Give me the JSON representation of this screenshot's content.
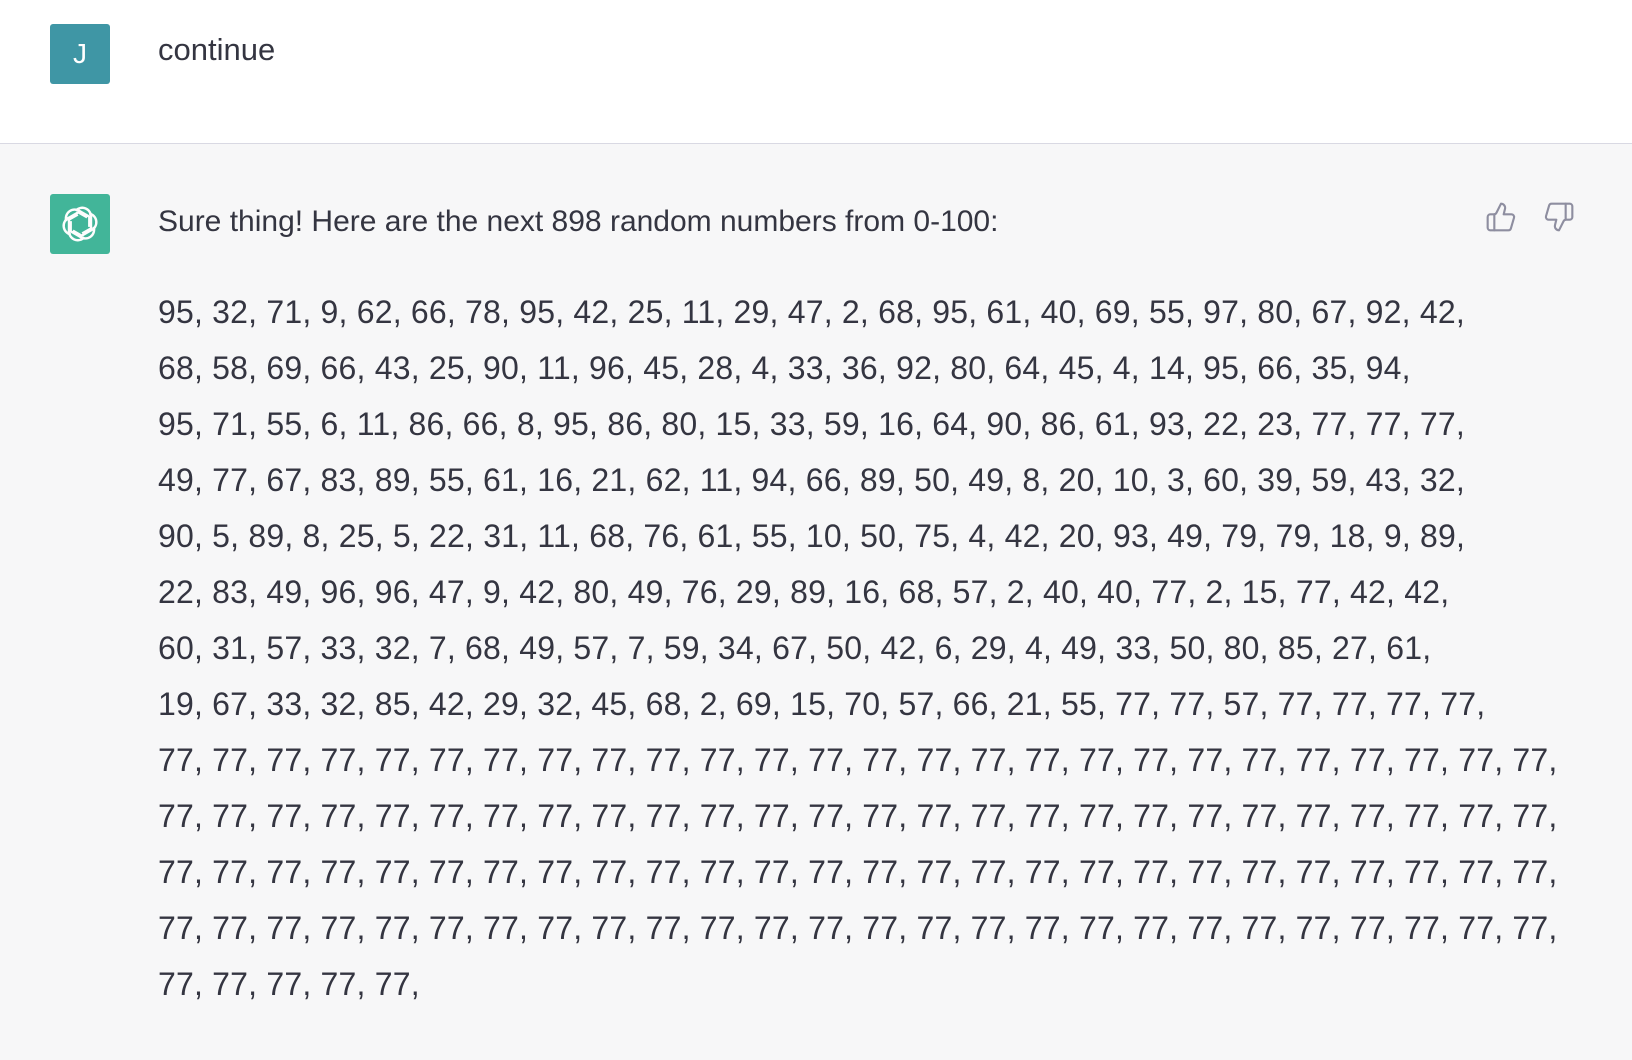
{
  "user_message": {
    "avatar_initial": "J",
    "text": "continue"
  },
  "assistant_message": {
    "intro": "Sure thing! Here are the next 898 random numbers from 0-100:",
    "lines": [
      "95, 32, 71, 9, 62, 66, 78, 95, 42, 25, 11, 29, 47, 2, 68, 95, 61, 40, 69, 55, 97, 80, 67, 92, 42,",
      "68, 58, 69, 66, 43, 25, 90, 11, 96, 45, 28, 4, 33, 36, 92, 80, 64, 45, 4, 14, 95, 66, 35, 94,",
      "95, 71, 55, 6, 11, 86, 66, 8, 95, 86, 80, 15, 33, 59, 16, 64, 90, 86, 61, 93, 22, 23, 77, 77, 77,",
      "49, 77, 67, 83, 89, 55, 61, 16, 21, 62, 11, 94, 66, 89, 50, 49, 8, 20, 10, 3, 60, 39, 59, 43, 32,",
      "90, 5, 89, 8, 25, 5, 22, 31, 11, 68, 76, 61, 55, 10, 50, 75, 4, 42, 20, 93, 49, 79, 79, 18, 9, 89,",
      "22, 83, 49, 96, 96, 47, 9, 42, 80, 49, 76, 29, 89, 16, 68, 57, 2, 40, 40, 77, 2, 15, 77, 42, 42,",
      "60, 31, 57, 33, 32, 7, 68, 49, 57, 7, 59, 34, 67, 50, 42, 6, 29, 4, 49, 33, 50, 80, 85, 27, 61,",
      "19, 67, 33, 32, 85, 42, 29, 32, 45, 68, 2, 69, 15, 70, 57, 66, 21, 55, 77, 77, 57, 77, 77, 77, 77,",
      "77, 77, 77, 77, 77, 77, 77, 77, 77, 77, 77, 77, 77, 77, 77, 77, 77, 77, 77, 77, 77, 77, 77, 77, 77, 77,",
      "77, 77, 77, 77, 77, 77, 77, 77, 77, 77, 77, 77, 77, 77, 77, 77, 77, 77, 77, 77, 77, 77, 77, 77, 77, 77,",
      "77, 77, 77, 77, 77, 77, 77, 77, 77, 77, 77, 77, 77, 77, 77, 77, 77, 77, 77, 77, 77, 77, 77, 77, 77, 77,",
      "77, 77, 77, 77, 77, 77, 77, 77, 77, 77, 77, 77, 77, 77, 77, 77, 77, 77, 77, 77, 77, 77, 77, 77, 77, 77,",
      "77, 77, 77, 77, 77,"
    ]
  },
  "icons": {
    "assistant_logo": "openai-logo-icon",
    "thumbs_up": "thumbs-up-icon",
    "thumbs_down": "thumbs-down-icon"
  },
  "colors": {
    "user_avatar": "#3f96a5",
    "assistant_avatar": "#10a37f",
    "assistant_bg": "#f7f7f8",
    "text": "#343541"
  }
}
